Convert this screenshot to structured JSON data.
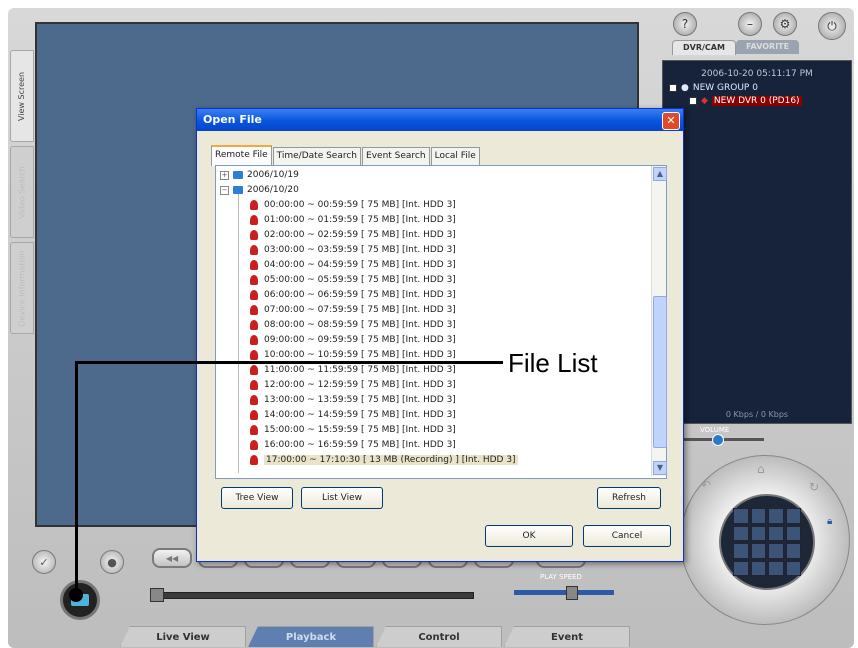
{
  "side_tabs": [
    "View Screen",
    "Video Search",
    "Device Information"
  ],
  "top_icons": [
    "help-icon",
    "minimize-icon",
    "settings-icon",
    "power-icon"
  ],
  "right_panel": {
    "tab_active": "DVR/CAM",
    "tab_inactive": "FAVORITE",
    "datetime": "2006-10-20 05:11:17 PM",
    "group": "NEW GROUP 0",
    "dvr": "NEW DVR 0 (PD16)",
    "bandwidth": "0 Kbps / 0 Kbps"
  },
  "volume": {
    "label": "VOLUME",
    "level": 0.5
  },
  "play_speed": {
    "label": "PLAY SPEED",
    "level": 0.55
  },
  "bottom_tabs": {
    "live_view": "Live View",
    "playback": "Playback",
    "control": "Control",
    "event": "Event"
  },
  "dialog": {
    "title": "Open File",
    "tabs": [
      "Remote File",
      "Time/Date Search",
      "Event Search",
      "Local File"
    ],
    "tree": {
      "date1": "2006/10/19",
      "date2": "2006/10/20"
    },
    "files": [
      "00:00:00 ~ 00:59:59  [ 75 MB]   [Int. HDD 3]",
      "01:00:00 ~ 01:59:59  [ 75 MB]   [Int. HDD 3]",
      "02:00:00 ~ 02:59:59  [ 75 MB]   [Int. HDD 3]",
      "03:00:00 ~ 03:59:59  [ 75 MB]   [Int. HDD 3]",
      "04:00:00 ~ 04:59:59  [ 75 MB]   [Int. HDD 3]",
      "05:00:00 ~ 05:59:59  [ 75 MB]   [Int. HDD 3]",
      "06:00:00 ~ 06:59:59  [ 75 MB]   [Int. HDD 3]",
      "07:00:00 ~ 07:59:59  [ 75 MB]   [Int. HDD 3]",
      "08:00:00 ~ 08:59:59  [ 75 MB]   [Int. HDD 3]",
      "09:00:00 ~ 09:59:59  [ 75 MB]   [Int. HDD 3]",
      "10:00:00 ~ 10:59:59  [ 75 MB]   [Int. HDD 3]",
      "11:00:00 ~ 11:59:59  [ 75 MB]   [Int. HDD 3]",
      "12:00:00 ~ 12:59:59  [ 75 MB]   [Int. HDD 3]",
      "13:00:00 ~ 13:59:59  [ 75 MB]   [Int. HDD 3]",
      "14:00:00 ~ 14:59:59  [ 75 MB]   [Int. HDD 3]",
      "15:00:00 ~ 15:59:59  [ 75 MB]   [Int. HDD 3]",
      "16:00:00 ~ 16:59:59  [ 75 MB]   [Int. HDD 3]",
      "17:00:00 ~ 17:10:30  [ 13 MB (Recording) ]   [Int. HDD 3]"
    ],
    "buttons": {
      "tree_view": "Tree View",
      "list_view": "List View",
      "refresh": "Refresh",
      "ok": "OK",
      "cancel": "Cancel"
    }
  },
  "callout": "File List"
}
